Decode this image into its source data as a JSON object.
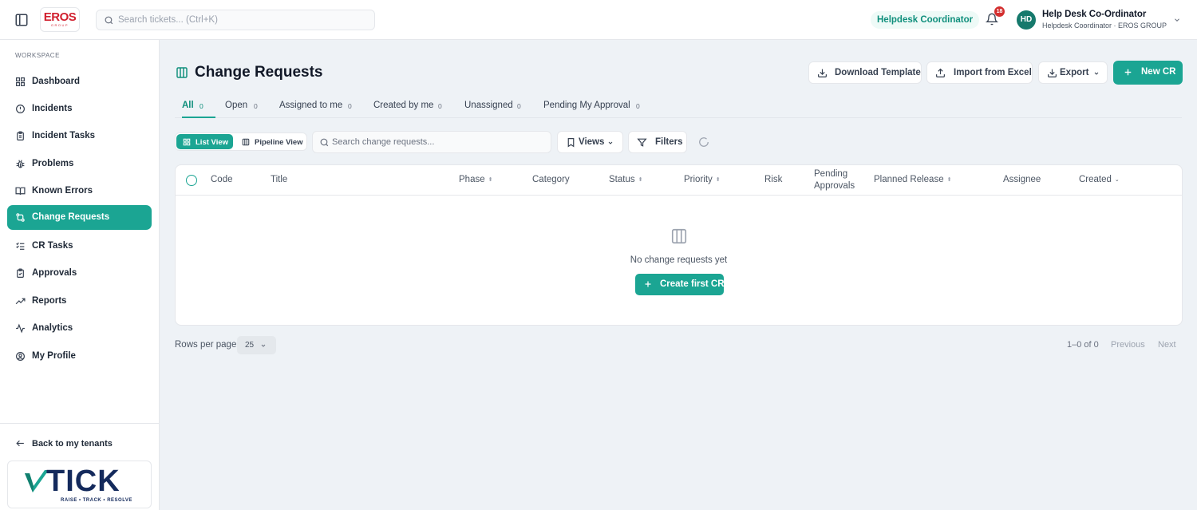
{
  "topbar": {
    "logo_text": "EROS",
    "logo_sub": "GROUP",
    "search_placeholder": "Search tickets... (Ctrl+K)",
    "role_pill": "Helpdesk Coordinator",
    "notification_count": "18",
    "user_initials": "HD",
    "user_name": "Help Desk Co-Ordinator",
    "user_subtitle": "Helpdesk Coordinator · EROS GROUP"
  },
  "sidebar": {
    "section_label": "WORKSPACE",
    "items": [
      {
        "label": "Dashboard",
        "icon": "dashboard-icon"
      },
      {
        "label": "Incidents",
        "icon": "alert-circle-icon"
      },
      {
        "label": "Incident Tasks",
        "icon": "clipboard-icon"
      },
      {
        "label": "Problems",
        "icon": "bug-icon"
      },
      {
        "label": "Known Errors",
        "icon": "book-icon"
      },
      {
        "label": "Change Requests",
        "icon": "git-compare-icon",
        "active": true
      },
      {
        "label": "CR Tasks",
        "icon": "list-checks-icon"
      },
      {
        "label": "Approvals",
        "icon": "clipboard-check-icon"
      },
      {
        "label": "Reports",
        "icon": "trending-up-icon"
      },
      {
        "label": "Analytics",
        "icon": "activity-icon"
      },
      {
        "label": "My Profile",
        "icon": "user-circle-icon"
      }
    ],
    "back_link": "Back to my tenants",
    "brand_name": "TICK",
    "brand_tagline": "RAISE • TRACK • RESOLVE"
  },
  "header": {
    "title": "Change Requests",
    "download_template": "Download Template",
    "import_excel": "Import from Excel",
    "export": "Export",
    "new_cr": "New CR"
  },
  "tabs": [
    {
      "label": "All",
      "count": "0",
      "active": true
    },
    {
      "label": "Open",
      "count": "0"
    },
    {
      "label": "Assigned to me",
      "count": "0"
    },
    {
      "label": "Created by me",
      "count": "0"
    },
    {
      "label": "Unassigned",
      "count": "0"
    },
    {
      "label": "Pending My Approval",
      "count": "0"
    }
  ],
  "toolbar": {
    "list_view": "List View",
    "pipeline_view": "Pipeline View",
    "search_placeholder": "Search change requests...",
    "views": "Views",
    "filters": "Filters"
  },
  "table": {
    "columns": [
      "Code",
      "Title",
      "Phase",
      "Category",
      "Status",
      "Priority",
      "Risk",
      "Pending Approvals",
      "Planned Release",
      "Assignee",
      "Created"
    ],
    "empty_message": "No change requests yet",
    "create_first": "Create first CR"
  },
  "pagination": {
    "rows_per_page_label": "Rows per page",
    "rows_per_page_value": "25",
    "range": "1–0 of 0",
    "previous": "Previous",
    "next": "Next"
  },
  "colors": {
    "accent": "#1ba593",
    "accent_dark": "#0f8f7c",
    "badge_red": "#d32f2f",
    "brand_navy": "#142a5c",
    "logo_red": "#d11f2e"
  }
}
